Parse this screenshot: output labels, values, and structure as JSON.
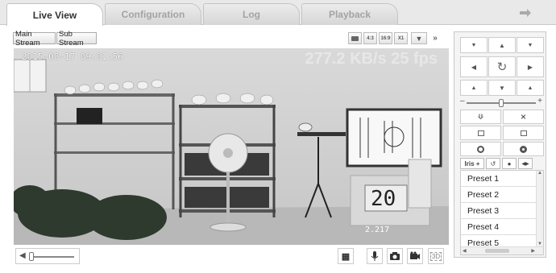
{
  "tabs": [
    {
      "label": "Live View",
      "active": true
    },
    {
      "label": "Configuration",
      "active": false
    },
    {
      "label": "Log",
      "active": false
    },
    {
      "label": "Playback",
      "active": false
    }
  ],
  "exit_icon": "logout-arrow-icon",
  "stream": {
    "main_label": "Main Stream",
    "sub_label": "Sub Stream"
  },
  "ratio": {
    "r43": "4:3",
    "r169": "16:9",
    "x1": "X1"
  },
  "video": {
    "timestamp": "2015-08-17 09:01:56",
    "rate": "277.2 KB/s 25 fps",
    "sign_number": "20",
    "corner_number": "2.217"
  },
  "volume_icon": "speaker-icon",
  "ptz": {
    "speed_percent": 50,
    "tabs": {
      "iris": "Iris +"
    },
    "presets": [
      "Preset 1",
      "Preset 2",
      "Preset 3",
      "Preset 4",
      "Preset 5"
    ]
  },
  "colors": {
    "accent": "#333333",
    "panel": "#f4f4f4",
    "tab_inactive_text": "#a3a3a3"
  }
}
